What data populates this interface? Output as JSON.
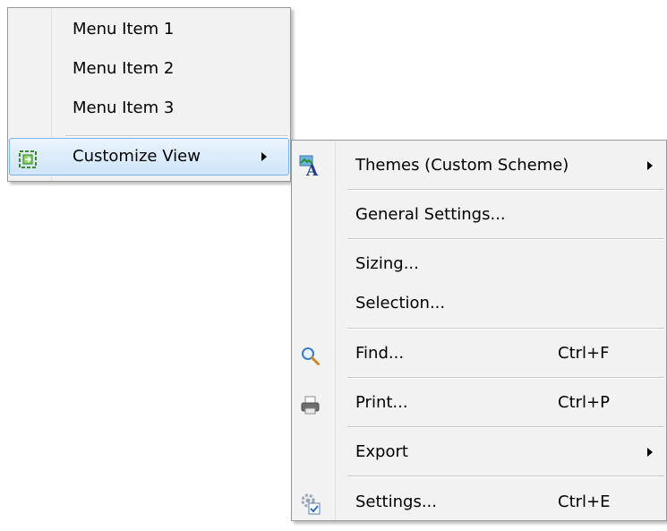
{
  "main_menu": {
    "items": [
      {
        "label": "Menu Item 1"
      },
      {
        "label": "Menu Item 2"
      },
      {
        "label": "Menu Item 3"
      }
    ],
    "customize": {
      "label": "Customize View",
      "icon": "customize-view-icon",
      "highlighted": true,
      "has_submenu": true
    }
  },
  "submenu": {
    "themes": {
      "label": "Themes (Custom Scheme)",
      "icon": "themes-icon",
      "has_submenu": true
    },
    "general_settings": {
      "label": "General Settings..."
    },
    "sizing": {
      "label": "Sizing..."
    },
    "selection": {
      "label": "Selection..."
    },
    "find": {
      "label": "Find...",
      "shortcut": "Ctrl+F",
      "icon": "magnifier-icon"
    },
    "print": {
      "label": "Print...",
      "shortcut": "Ctrl+P",
      "icon": "printer-icon"
    },
    "export": {
      "label": "Export",
      "has_submenu": true
    },
    "settings": {
      "label": "Settings...",
      "shortcut": "Ctrl+E",
      "icon": "settings-gear-icon"
    }
  },
  "colors": {
    "menu_background": "#f2f2f2",
    "highlight_border": "#7bb4e8",
    "highlight_fill": "#d9ebfb"
  }
}
